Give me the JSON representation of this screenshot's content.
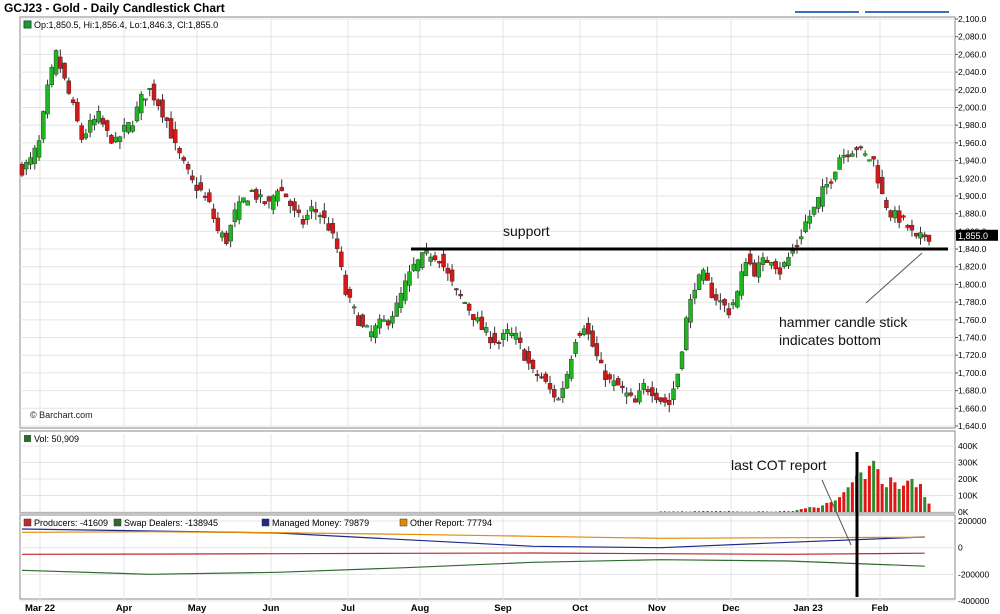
{
  "header": {
    "title": "GCJ23 - Gold - Daily Candlestick Chart"
  },
  "legend": {
    "ohlc": "Op:1,850.5, Hi:1,856.4, Lo:1,846.3, Cl:1,855.0",
    "volume": "Vol: 50,909",
    "cot": [
      {
        "label": "Producers: -41609",
        "color": "#c0282d"
      },
      {
        "label": "Swap Dealers: -138945",
        "color": "#2f6b2f"
      },
      {
        "label": "Managed Money: 79879",
        "color": "#1f2a8c"
      },
      {
        "label": "Other Report: 77794",
        "color": "#e08a00"
      }
    ]
  },
  "watermark": "© Barchart.com",
  "annotations": {
    "support": "support",
    "hammer_line1": "hammer candle stick",
    "hammer_line2": "indicates bottom",
    "cot": "last COT report"
  },
  "last_price": "1,855.0",
  "chart_data": {
    "type": "candlestick",
    "title": "GCJ23 - Gold - Daily Candlestick Chart",
    "price_axis": {
      "ylim": [
        1640,
        2100
      ],
      "ticks": [
        "2,100.0",
        "2,080.0",
        "2,060.0",
        "2,040.0",
        "2,020.0",
        "2,000.0",
        "1,980.0",
        "1,960.0",
        "1,940.0",
        "1,920.0",
        "1,900.0",
        "1,880.0",
        "1,860.0",
        "1,840.0",
        "1,820.0",
        "1,800.0",
        "1,780.0",
        "1,760.0",
        "1,740.0",
        "1,720.0",
        "1,700.0",
        "1,680.0",
        "1,660.0",
        "1,640.0"
      ]
    },
    "volume_axis": {
      "ylim": [
        0,
        400000
      ],
      "ticks": [
        "400K",
        "300K",
        "200K",
        "100K",
        "0K"
      ]
    },
    "cot_axis": {
      "ylim": [
        -400000,
        200000
      ],
      "ticks": [
        "200000",
        "0",
        "-200000",
        "-400000"
      ]
    },
    "x_months": [
      "Mar 22",
      "Apr",
      "May",
      "Jun",
      "Jul",
      "Aug",
      "Sep",
      "Oct",
      "Nov",
      "Dec",
      "Jan 23",
      "Feb"
    ],
    "support_level": 1840,
    "close_path": [
      [
        0,
        1930
      ],
      [
        2,
        1940
      ],
      [
        4,
        1960
      ],
      [
        6,
        2020
      ],
      [
        8,
        2060
      ],
      [
        10,
        2030
      ],
      [
        12,
        2000
      ],
      [
        14,
        1965
      ],
      [
        16,
        1980
      ],
      [
        18,
        1990
      ],
      [
        20,
        1970
      ],
      [
        22,
        1960
      ],
      [
        24,
        1975
      ],
      [
        26,
        1985
      ],
      [
        28,
        2010
      ],
      [
        30,
        2020
      ],
      [
        32,
        2005
      ],
      [
        34,
        1985
      ],
      [
        36,
        1955
      ],
      [
        38,
        1935
      ],
      [
        40,
        1915
      ],
      [
        42,
        1905
      ],
      [
        44,
        1890
      ],
      [
        46,
        1860
      ],
      [
        48,
        1850
      ],
      [
        50,
        1880
      ],
      [
        52,
        1895
      ],
      [
        54,
        1905
      ],
      [
        56,
        1895
      ],
      [
        58,
        1890
      ],
      [
        60,
        1910
      ],
      [
        62,
        1900
      ],
      [
        64,
        1880
      ],
      [
        66,
        1870
      ],
      [
        68,
        1885
      ],
      [
        70,
        1880
      ],
      [
        72,
        1865
      ],
      [
        74,
        1840
      ],
      [
        76,
        1790
      ],
      [
        78,
        1770
      ],
      [
        80,
        1750
      ],
      [
        82,
        1745
      ],
      [
        84,
        1755
      ],
      [
        86,
        1760
      ],
      [
        88,
        1775
      ],
      [
        90,
        1800
      ],
      [
        92,
        1820
      ],
      [
        94,
        1830
      ],
      [
        96,
        1835
      ],
      [
        98,
        1830
      ],
      [
        100,
        1810
      ],
      [
        102,
        1790
      ],
      [
        104,
        1780
      ],
      [
        106,
        1765
      ],
      [
        108,
        1750
      ],
      [
        110,
        1740
      ],
      [
        112,
        1735
      ],
      [
        114,
        1745
      ],
      [
        116,
        1740
      ],
      [
        118,
        1720
      ],
      [
        120,
        1700
      ],
      [
        122,
        1695
      ],
      [
        124,
        1680
      ],
      [
        126,
        1670
      ],
      [
        128,
        1700
      ],
      [
        130,
        1740
      ],
      [
        132,
        1755
      ],
      [
        134,
        1730
      ],
      [
        136,
        1705
      ],
      [
        138,
        1690
      ],
      [
        140,
        1685
      ],
      [
        142,
        1675
      ],
      [
        144,
        1665
      ],
      [
        146,
        1685
      ],
      [
        148,
        1680
      ],
      [
        150,
        1670
      ],
      [
        152,
        1665
      ],
      [
        154,
        1700
      ],
      [
        156,
        1760
      ],
      [
        158,
        1800
      ],
      [
        160,
        1810
      ],
      [
        162,
        1790
      ],
      [
        164,
        1780
      ],
      [
        166,
        1770
      ],
      [
        168,
        1790
      ],
      [
        170,
        1830
      ],
      [
        172,
        1815
      ],
      [
        174,
        1825
      ],
      [
        176,
        1830
      ],
      [
        178,
        1815
      ],
      [
        180,
        1830
      ],
      [
        182,
        1845
      ],
      [
        184,
        1870
      ],
      [
        186,
        1885
      ],
      [
        188,
        1905
      ],
      [
        190,
        1920
      ],
      [
        192,
        1945
      ],
      [
        194,
        1950
      ],
      [
        196,
        1955
      ],
      [
        198,
        1945
      ],
      [
        200,
        1940
      ],
      [
        202,
        1900
      ],
      [
        204,
        1880
      ],
      [
        206,
        1875
      ],
      [
        208,
        1865
      ],
      [
        210,
        1850
      ],
      [
        212,
        1855
      ]
    ],
    "volume_recent": [
      12000,
      18000,
      22000,
      30000,
      28000,
      25000,
      40000,
      55000,
      60000,
      70000,
      90000,
      120000,
      150000,
      180000,
      220000,
      240000,
      200000,
      280000,
      310000,
      260000,
      170000,
      150000,
      210000,
      180000,
      140000,
      160000,
      190000,
      200000,
      150000,
      170000,
      90000,
      50909
    ],
    "cot_series": [
      {
        "name": "Producers",
        "values": [
          [
            0,
            -50000
          ],
          [
            30,
            -48000
          ],
          [
            60,
            -45000
          ],
          [
            90,
            -42000
          ],
          [
            120,
            -40000
          ],
          [
            150,
            -45000
          ],
          [
            180,
            -50000
          ],
          [
            212,
            -41609
          ]
        ]
      },
      {
        "name": "Swap Dealers",
        "values": [
          [
            0,
            -170000
          ],
          [
            30,
            -200000
          ],
          [
            60,
            -185000
          ],
          [
            90,
            -150000
          ],
          [
            120,
            -110000
          ],
          [
            150,
            -90000
          ],
          [
            180,
            -100000
          ],
          [
            212,
            -138945
          ]
        ]
      },
      {
        "name": "Managed Money",
        "values": [
          [
            0,
            140000
          ],
          [
            30,
            125000
          ],
          [
            60,
            110000
          ],
          [
            90,
            60000
          ],
          [
            120,
            10000
          ],
          [
            150,
            0
          ],
          [
            180,
            40000
          ],
          [
            212,
            79879
          ]
        ]
      },
      {
        "name": "Other Report",
        "values": [
          [
            0,
            115000
          ],
          [
            30,
            120000
          ],
          [
            60,
            112000
          ],
          [
            90,
            100000
          ],
          [
            120,
            85000
          ],
          [
            150,
            70000
          ],
          [
            180,
            75000
          ],
          [
            212,
            77794
          ]
        ]
      }
    ]
  }
}
